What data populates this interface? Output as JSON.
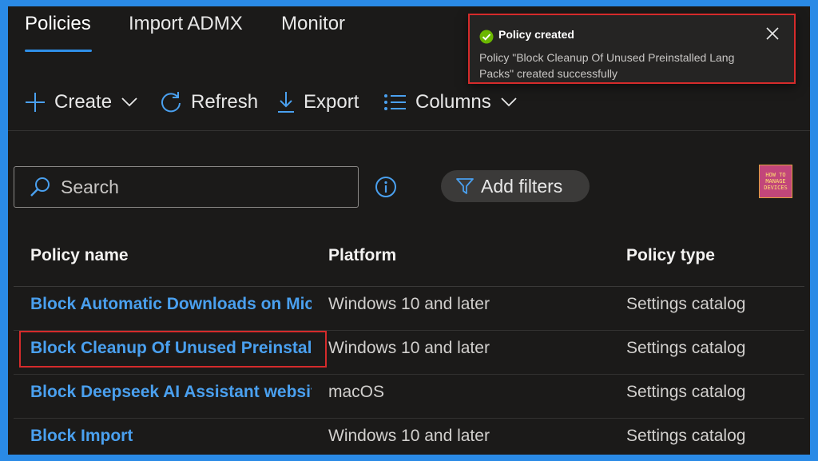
{
  "tabs": [
    {
      "label": "Policies"
    },
    {
      "label": "Import ADMX"
    },
    {
      "label": "Monitor"
    }
  ],
  "toolbar": {
    "create_label": "Create",
    "refresh_label": "Refresh",
    "export_label": "Export",
    "columns_label": "Columns"
  },
  "search": {
    "placeholder": "Search",
    "value": ""
  },
  "filters": {
    "add_label": "Add filters"
  },
  "logo": {
    "line1": "HOW TO",
    "line2": "MANAGE",
    "line3": "DEVICES"
  },
  "table": {
    "columns": [
      "Policy name",
      "Platform",
      "Policy type"
    ],
    "rows": [
      {
        "name": "Block Automatic Downloads on Microsoft Edge",
        "platform": "Windows 10 and later",
        "type": "Settings catalog"
      },
      {
        "name": "Block Cleanup Of Unused Preinstalled Lang Packs",
        "platform": "Windows 10 and later",
        "type": "Settings catalog"
      },
      {
        "name": "Block Deepseek AI Assistant website",
        "platform": "macOS",
        "type": "Settings catalog"
      },
      {
        "name": "Block Import",
        "platform": "Windows 10 and later",
        "type": "Settings catalog"
      }
    ]
  },
  "toast": {
    "title": "Policy created",
    "message": "Policy \"Block Cleanup Of Unused Preinstalled Lang Packs\" created successfully"
  },
  "colors": {
    "accent": "#2f8fe8",
    "link": "#4aa0ef",
    "success": "#6bb700",
    "highlight": "#d52b2b",
    "background": "#1b1a19"
  }
}
